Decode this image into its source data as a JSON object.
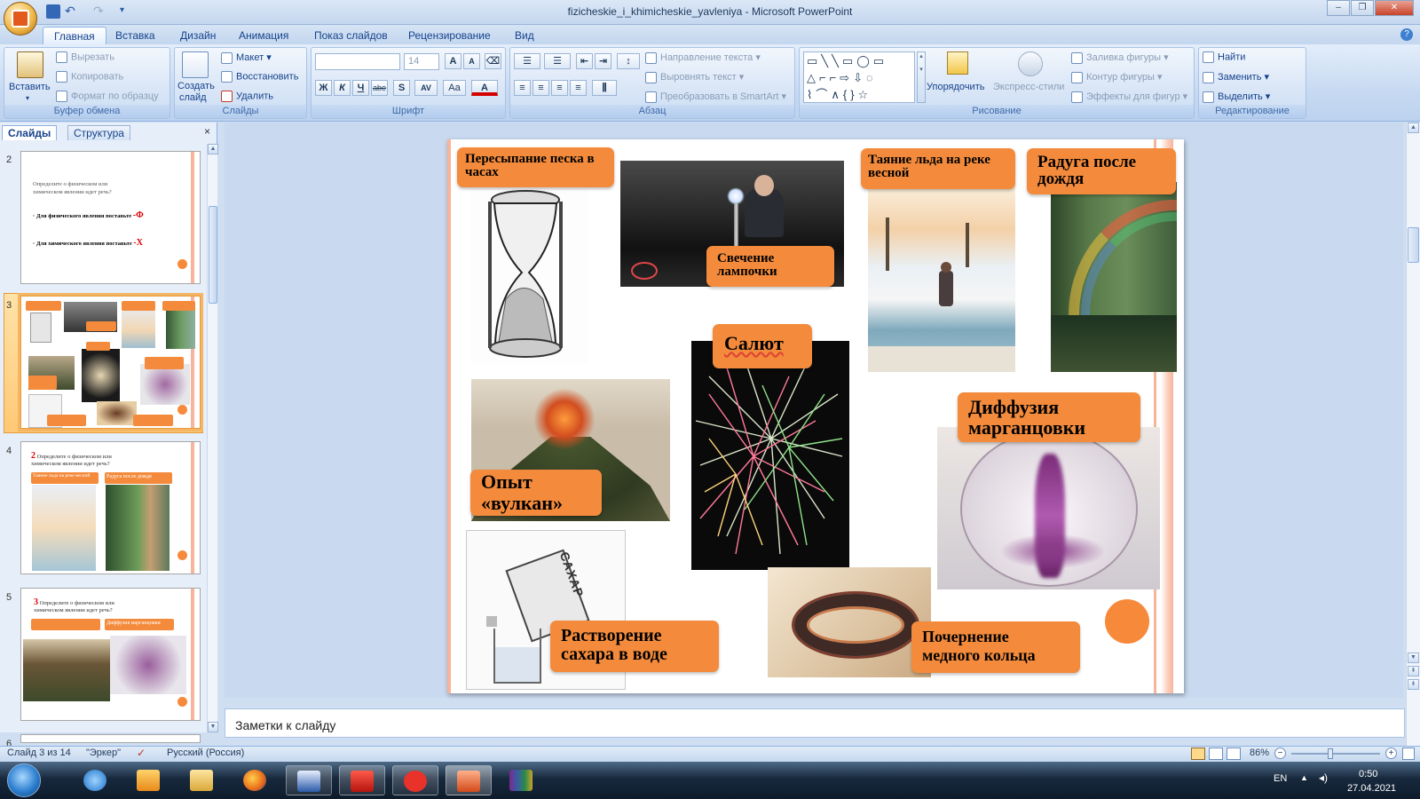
{
  "window": {
    "title": "fizicheskie_i_khimicheskie_yavleniya - Microsoft PowerPoint"
  },
  "tabs": [
    "Главная",
    "Вставка",
    "Дизайн",
    "Анимация",
    "Показ слайдов",
    "Рецензирование",
    "Вид"
  ],
  "ribbon": {
    "clipboard": {
      "label": "Буфер обмена",
      "paste": "Вставить",
      "cut": "Вырезать",
      "copy": "Копировать",
      "format_painter": "Формат по образцу"
    },
    "slides": {
      "label": "Слайды",
      "new_slide_1": "Создать",
      "new_slide_2": "слайд",
      "layout": "Макет",
      "reset": "Восстановить",
      "delete": "Удалить"
    },
    "font": {
      "label": "Шрифт",
      "font_size": "14",
      "bold": "Ж",
      "italic": "К",
      "underline": "Ч",
      "strike": "abe",
      "shadow": "S",
      "spacing": "AV",
      "case": "Aa",
      "color": "A",
      "grow": "A",
      "shrink": "A"
    },
    "paragraph": {
      "label": "Абзац",
      "text_direction": "Направление текста",
      "align_text": "Выровнять текст",
      "convert_smartart": "Преобразовать в SmartArt"
    },
    "drawing": {
      "label": "Рисование",
      "arrange": "Упорядочить",
      "quick_styles": "Экспресс-стили",
      "shape_fill": "Заливка фигуры",
      "shape_outline": "Контур фигуры",
      "shape_effects": "Эффекты для фигур"
    },
    "editing": {
      "label": "Редактирование",
      "find": "Найти",
      "replace": "Заменить",
      "select": "Выделить"
    }
  },
  "panel": {
    "tab_slides": "Слайды",
    "tab_outline": "Структура",
    "close": "×"
  },
  "thumbnails": [
    {
      "num": "2",
      "line1": "Определите о физическом или",
      "line2": "химическом явлении идет речь?",
      "item1": "Для физического явления поставьте",
      "mark1": "-Ф",
      "item2": "Для химического явления поставьте",
      "mark2": "-Х"
    },
    {
      "num": "3"
    },
    {
      "num": "4",
      "prefix": "2",
      "line1": "Определите о физическом или",
      "line2": "химическом явлении идет речь?",
      "box1": "Таяние льда на реке весной",
      "box2": "Радуга после дождя"
    },
    {
      "num": "5",
      "prefix": "3",
      "line1": "Определите о физическом или",
      "line2": "химическом явлении идет речь?",
      "box2": "Диффузия марганцовки"
    },
    {
      "num": "6"
    }
  ],
  "slide": {
    "labels": {
      "sand": "Пересыпание песка в часах",
      "lamp": "Свечение лампочки",
      "ice": "Таяние льда на реке весной",
      "rainbow": "Радуга после дождя",
      "salute": "Салют",
      "volcano_1": "Опыт",
      "volcano_2": "«вулкан»",
      "diffusion_1": "Диффузия",
      "diffusion_2": "марганцовки",
      "sugar_1": "Растворение",
      "sugar_2": "сахара в воде",
      "ring_1": "Почернение",
      "ring_2": "медного кольца"
    },
    "sugar_pack_text": "САХАР"
  },
  "notes": {
    "placeholder": "Заметки к слайду"
  },
  "status": {
    "slide_pos": "Слайд 3 из 14",
    "theme": "\"Эркер\"",
    "language": "Русский (Россия)",
    "zoom": "86%"
  },
  "taskbar": {
    "lang": "EN",
    "time": "0:50",
    "date": "27.04.2021"
  },
  "colors": {
    "accent_orange": "#f48b3c",
    "slide_border": "#f7b49a"
  }
}
